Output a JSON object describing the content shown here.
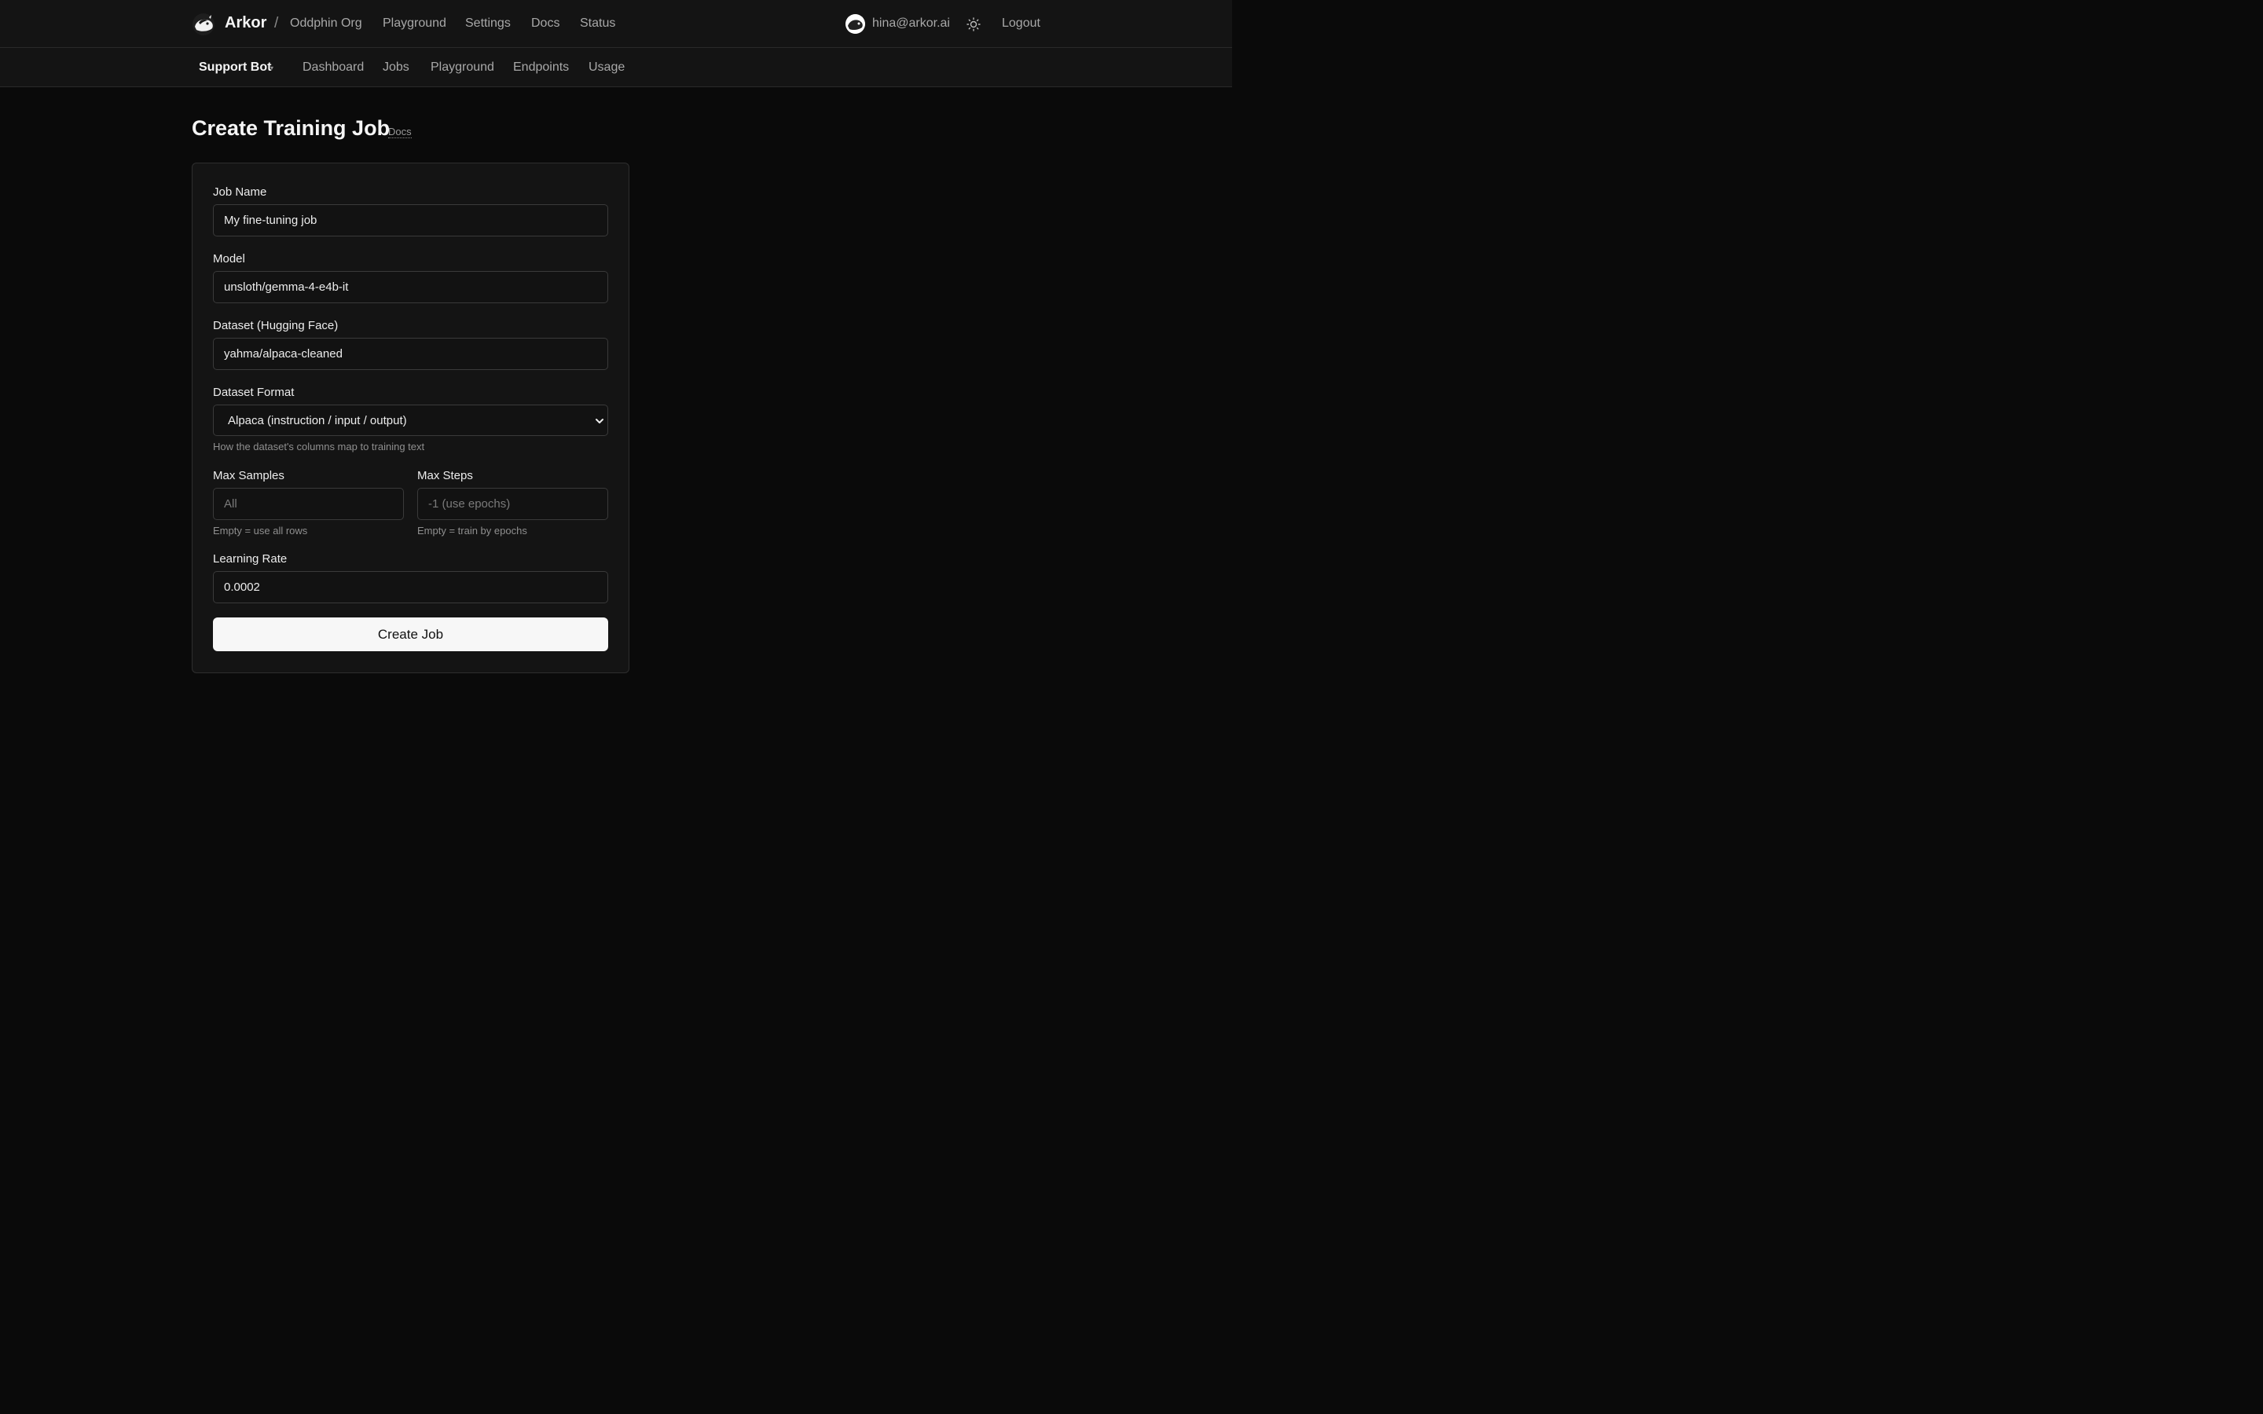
{
  "header": {
    "brand": "Arkor",
    "separator": "/",
    "org": "Oddphin Org",
    "nav": [
      "Playground",
      "Settings",
      "Docs",
      "Status"
    ],
    "user_email": "hina@arkor.ai",
    "theme_icon": "sun-icon",
    "logout_label": "Logout"
  },
  "subheader": {
    "project": "Support Bot",
    "project_caret": "▾",
    "nav": [
      "Dashboard",
      "Jobs",
      "Playground",
      "Endpoints",
      "Usage"
    ]
  },
  "page": {
    "title": "Create Training Job",
    "docs_link": "Docs"
  },
  "form": {
    "job_name": {
      "label": "Job Name",
      "value": "My fine-tuning job"
    },
    "model": {
      "label": "Model",
      "value": "unsloth/gemma-4-e4b-it"
    },
    "dataset": {
      "label": "Dataset (Hugging Face)",
      "value": "yahma/alpaca-cleaned"
    },
    "dataset_format": {
      "label": "Dataset Format",
      "selected": "Alpaca (instruction / input / output)",
      "help": "How the dataset's columns map to training text"
    },
    "max_samples": {
      "label": "Max Samples",
      "placeholder": "All",
      "help": "Empty = use all rows"
    },
    "max_steps": {
      "label": "Max Steps",
      "placeholder": "-1 (use epochs)",
      "help": "Empty = train by epochs"
    },
    "learning_rate": {
      "label": "Learning Rate",
      "value": "0.0002"
    },
    "submit_label": "Create Job"
  }
}
